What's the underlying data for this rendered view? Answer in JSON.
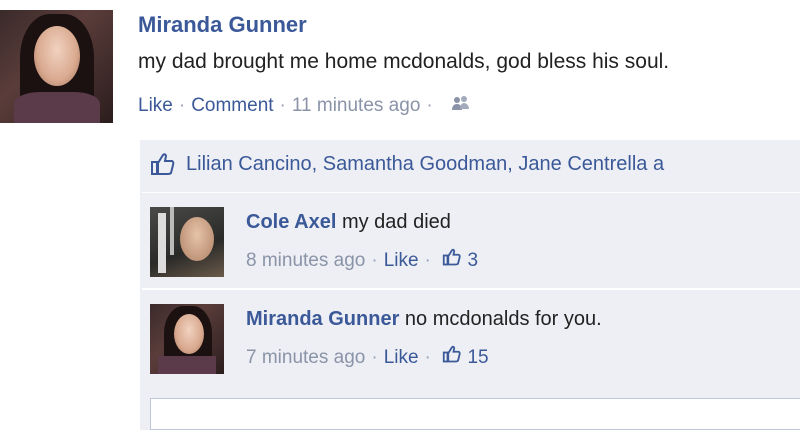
{
  "post": {
    "author": "Miranda Gunner",
    "text": "my dad brought me home mcdonalds, god bless his soul.",
    "like_label": "Like",
    "comment_label": "Comment",
    "timestamp": "11 minutes ago",
    "privacy_icon": "friends-icon"
  },
  "likes": {
    "names": "Lilian Cancino, Samantha Goodman, Jane Centrella a"
  },
  "comments": [
    {
      "author": "Cole Axel",
      "text": "my dad died",
      "timestamp": "8 minutes ago",
      "like_label": "Like",
      "like_count": "3"
    },
    {
      "author": "Miranda Gunner",
      "text": "no mcdonalds for you.",
      "timestamp": "7 minutes ago",
      "like_label": "Like",
      "like_count": "15"
    }
  ],
  "colors": {
    "link": "#3b5998",
    "muted": "#8a93a8",
    "feedback_bg": "#edeff4"
  }
}
